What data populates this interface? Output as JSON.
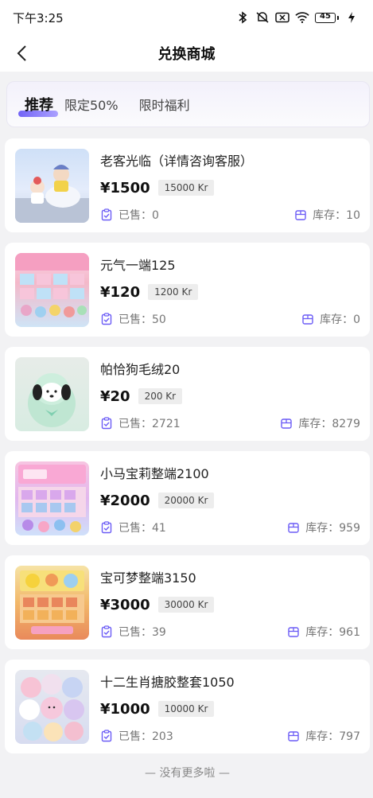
{
  "status": {
    "time": "下午3:25",
    "battery": "45"
  },
  "nav": {
    "title": "兑换商城"
  },
  "tabs": [
    {
      "label": "推荐"
    },
    {
      "label": "限定50%"
    },
    {
      "label": "限时福利"
    }
  ],
  "labels": {
    "sold": "已售：",
    "stock": "库存："
  },
  "products": [
    {
      "name": "老客光临（详情咨询客服）",
      "price": "¥1500",
      "kr": "15000 Kr",
      "sold": "0",
      "stock": "10"
    },
    {
      "name": "元气一端125",
      "price": "¥120",
      "kr": "1200 Kr",
      "sold": "50",
      "stock": "0"
    },
    {
      "name": "帕恰狗毛绒20",
      "price": "¥20",
      "kr": "200 Kr",
      "sold": "2721",
      "stock": "8279"
    },
    {
      "name": "小马宝莉整端2100",
      "price": "¥2000",
      "kr": "20000 Kr",
      "sold": "41",
      "stock": "959"
    },
    {
      "name": "宝可梦整端3150",
      "price": "¥3000",
      "kr": "30000 Kr",
      "sold": "39",
      "stock": "961"
    },
    {
      "name": "十二生肖搪胶整套1050",
      "price": "¥1000",
      "kr": "10000 Kr",
      "sold": "203",
      "stock": "797"
    }
  ],
  "footer": {
    "end_text": "— 没有更多啦 —"
  },
  "colors": {
    "accent": "#6b5cf6",
    "background": "#f2f2f4"
  }
}
